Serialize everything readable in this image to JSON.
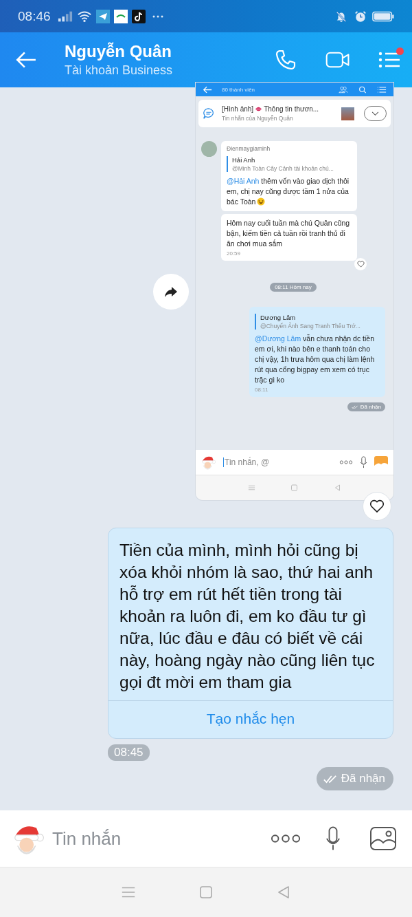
{
  "status_bar": {
    "time": "08:46"
  },
  "header": {
    "title": "Nguyễn Quân",
    "subtitle": "Tài khoản Business",
    "menu_badge": true
  },
  "shared_screenshot": {
    "member_count": "80 thành viên",
    "pinned": {
      "label": "[Hình ảnh]",
      "title": "Thông tin thươn...",
      "subtitle": "Tin nhắn của Nguyễn Quân"
    },
    "messages": [
      {
        "kind": "incoming",
        "sender": "Đienmaygiaminh",
        "quote": {
          "name": "Hải Anh",
          "text": "@Minh Toàn Cây Cảnh tài khoản chú..."
        },
        "mention": "@Hải Anh",
        "text": "thêm vốn vào giao dịch thôi em, chị nay cũng được tầm 1 nửa của bác Toàn",
        "emoji": true
      },
      {
        "kind": "incoming",
        "text": "Hôm nay cuối tuần mà chú Quân cũng bận, kiếm tiền cả tuần rồi tranh thủ đi ăn chơi mua sắm",
        "time": "20:59",
        "reaction": true
      },
      {
        "kind": "divider",
        "text": "08:11 Hôm nay"
      },
      {
        "kind": "outgoing",
        "quote": {
          "name": "Dương Lâm",
          "text": "@Chuyển Ảnh Sang Tranh Thêu Trớ..."
        },
        "mention": "@Dương Lâm",
        "text": "vẫn chưa nhận dc tiền em ơi, khi nào bên e thanh toán cho chị vậy, 1h trưa hôm qua chị làm lệnh rút qua cổng bigpay em xem có trục trặc gì ko",
        "time": "08:11"
      }
    ],
    "status": "Đã nhận",
    "input_placeholder": "Tin nhắn, @"
  },
  "message": {
    "text": "Tiền của mình, mình hỏi cũng bị xóa khỏi nhóm là sao, thứ hai anh hỗ trợ em rút hết tiền trong tài khoản ra luôn đi, em ko đầu tư gì nữa, lúc đầu e đâu có biết về cái này, hoàng ngày nào cũng liên tục gọi đt mời em tham gia",
    "action": "Tạo nhắc hẹn",
    "time": "08:45",
    "status": "Đã nhận"
  },
  "composer": {
    "placeholder": "Tin nhắn"
  }
}
